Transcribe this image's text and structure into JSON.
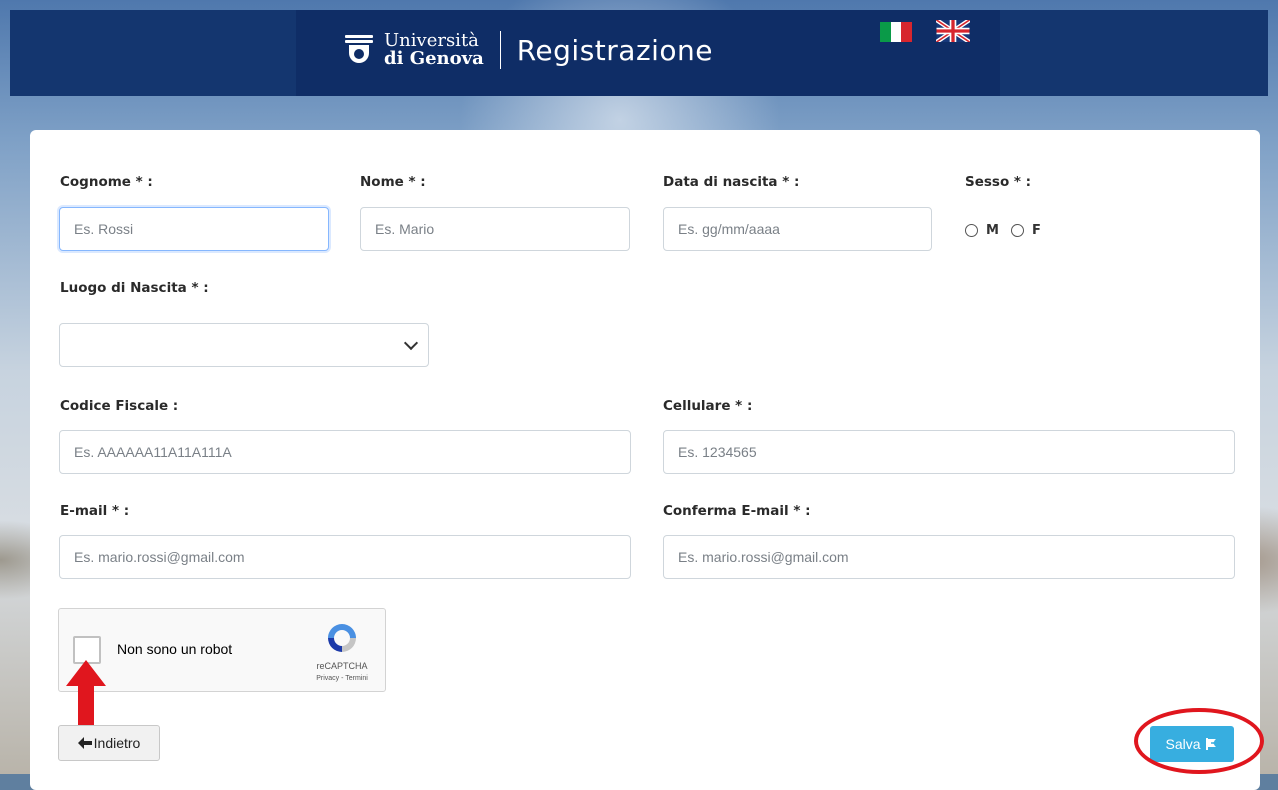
{
  "header": {
    "university_line1": "Università",
    "university_line2": "di Genova",
    "title": "Registrazione"
  },
  "languages": [
    {
      "code": "it",
      "icon": "italy-flag-icon"
    },
    {
      "code": "en",
      "icon": "uk-flag-icon"
    }
  ],
  "form": {
    "cognome": {
      "label": "Cognome * :",
      "placeholder": "Es. Rossi",
      "value": ""
    },
    "nome": {
      "label": "Nome * :",
      "placeholder": "Es. Mario",
      "value": ""
    },
    "data_nascita": {
      "label": "Data di nascita * :",
      "placeholder": "Es. gg/mm/aaaa",
      "value": ""
    },
    "sesso": {
      "label": "Sesso * :",
      "options": [
        "M",
        "F"
      ]
    },
    "luogo_nascita": {
      "label": "Luogo di Nascita * :",
      "value": ""
    },
    "codice_fiscale": {
      "label": "Codice Fiscale :",
      "placeholder": "Es. AAAAAA11A11A111A",
      "value": ""
    },
    "cellulare": {
      "label": "Cellulare * :",
      "placeholder": "Es. 1234565",
      "value": ""
    },
    "email": {
      "label": "E-mail * :",
      "placeholder": "Es. mario.rossi@gmail.com",
      "value": ""
    },
    "conferma_email": {
      "label": "Conferma E-mail * :",
      "placeholder": "Es. mario.rossi@gmail.com",
      "value": ""
    }
  },
  "captcha": {
    "text": "Non sono un robot",
    "brand": "reCAPTCHA",
    "links": "Privacy - Termini"
  },
  "buttons": {
    "back_label": "Indietro",
    "save_label": "Salva"
  },
  "colors": {
    "header": "#0f2d66",
    "save_button": "#37aee0",
    "annotation": "#e0161e"
  }
}
